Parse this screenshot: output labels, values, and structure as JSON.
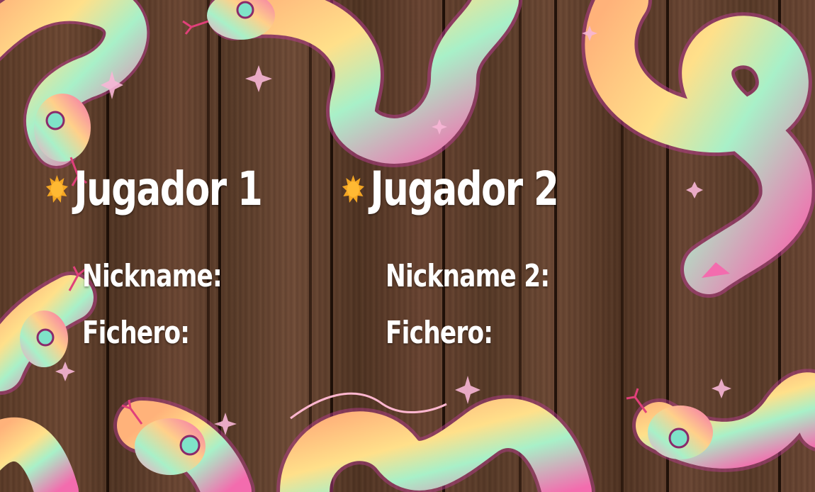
{
  "player1": {
    "title": "Jugador 1",
    "nickname_label": "Nickname:",
    "file_label": "Fichero:"
  },
  "player2": {
    "title": "Jugador 2",
    "nickname_label": "Nickname 2:",
    "file_label": "Fichero:"
  },
  "icons": {
    "bullet": "sun-icon",
    "decoration": "snake-icon"
  },
  "colors": {
    "text": "#ffffff",
    "bullet": "#f4a623",
    "snake_pink": "#f36cae",
    "snake_mint": "#9ff0c6",
    "snake_peach": "#ffc68a"
  }
}
